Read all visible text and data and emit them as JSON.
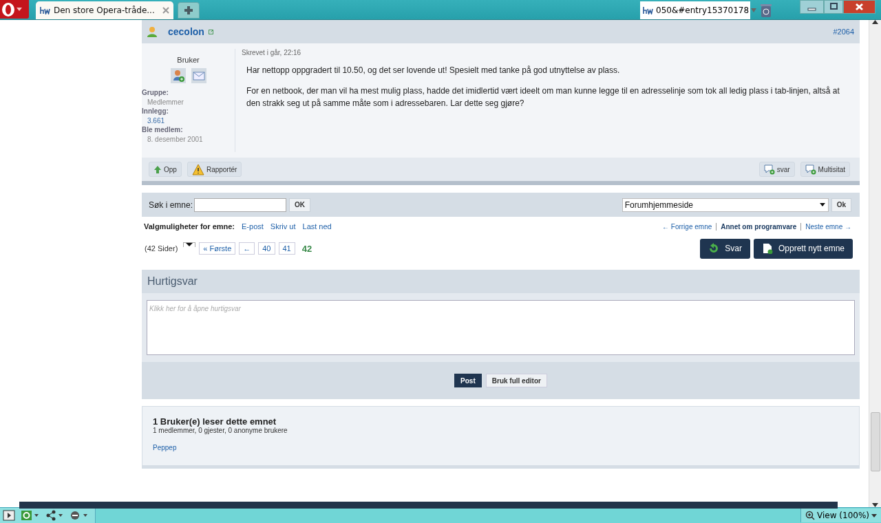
{
  "browser": {
    "tabs": [
      {
        "title": "Den store Opera-tråde...",
        "selected": true
      }
    ],
    "address": "050&#entry15370178"
  },
  "post": {
    "author": "cecolon",
    "number": "#2064",
    "role": "Bruker",
    "details": [
      {
        "label": "Gruppe:",
        "value": "Medlemmer"
      },
      {
        "label": "Innlegg:",
        "value": "3.661"
      },
      {
        "label": "Ble medlem:",
        "value": "8. desember 2001"
      }
    ],
    "date": "Skrevet i går, 22:16",
    "paragraphs": [
      "Har nettopp oppgradert til 10.50, og det ser lovende ut! Spesielt med tanke på god utnyttelse av plass.",
      "For en netbook, der man vil ha mest mulig plass, hadde det imidlertid vært ideelt om man kunne legge til en adresselinje som tok all ledig plass i tab-linjen, altså at den strakk seg ut på samme måte som i adressebaren. Lar dette seg gjøre?"
    ],
    "left_buttons": [
      "Opp",
      "Rapportér"
    ],
    "right_buttons": [
      "svar",
      "Multisitat"
    ]
  },
  "search": {
    "label": "Søk i emne:",
    "button": "OK",
    "jump": "Forumhjemmeside",
    "jump_button": "Ok"
  },
  "options": {
    "label": "Valgmuligheter for emne:",
    "links": [
      "E-post",
      "Skriv ut",
      "Last ned"
    ]
  },
  "topic_nav": [
    {
      "text": "← Forrige emne",
      "kind": "link"
    },
    {
      "text": "Annet om programvare",
      "kind": "current"
    },
    {
      "text": "Neste emne →",
      "kind": "link"
    }
  ],
  "pagination": {
    "count": "(42 Sider)",
    "pages": [
      {
        "label": "« Første",
        "selected": false
      },
      {
        "label": "←",
        "selected": false
      },
      {
        "label": "40",
        "selected": false
      },
      {
        "label": "41",
        "selected": false
      },
      {
        "label": "42",
        "selected": true
      }
    ]
  },
  "actions": [
    "Svar",
    "Opprett nytt emne"
  ],
  "quick_reply": {
    "title": "Hurtigsvar",
    "placeholder": "Klikk her for å åpne hurtigsvar",
    "buttons": [
      {
        "label": "Post",
        "kind": "primary"
      },
      {
        "label": "Bruk full editor",
        "kind": "secondary"
      }
    ]
  },
  "viewers": {
    "title": "1 Bruker(e) leser dette emnet",
    "summary": "1 medlemmer, 0 gjester, 0 anonyme brukere",
    "users": [
      "Peppep"
    ]
  },
  "status_bar": {
    "zoom": "View (100%)"
  }
}
